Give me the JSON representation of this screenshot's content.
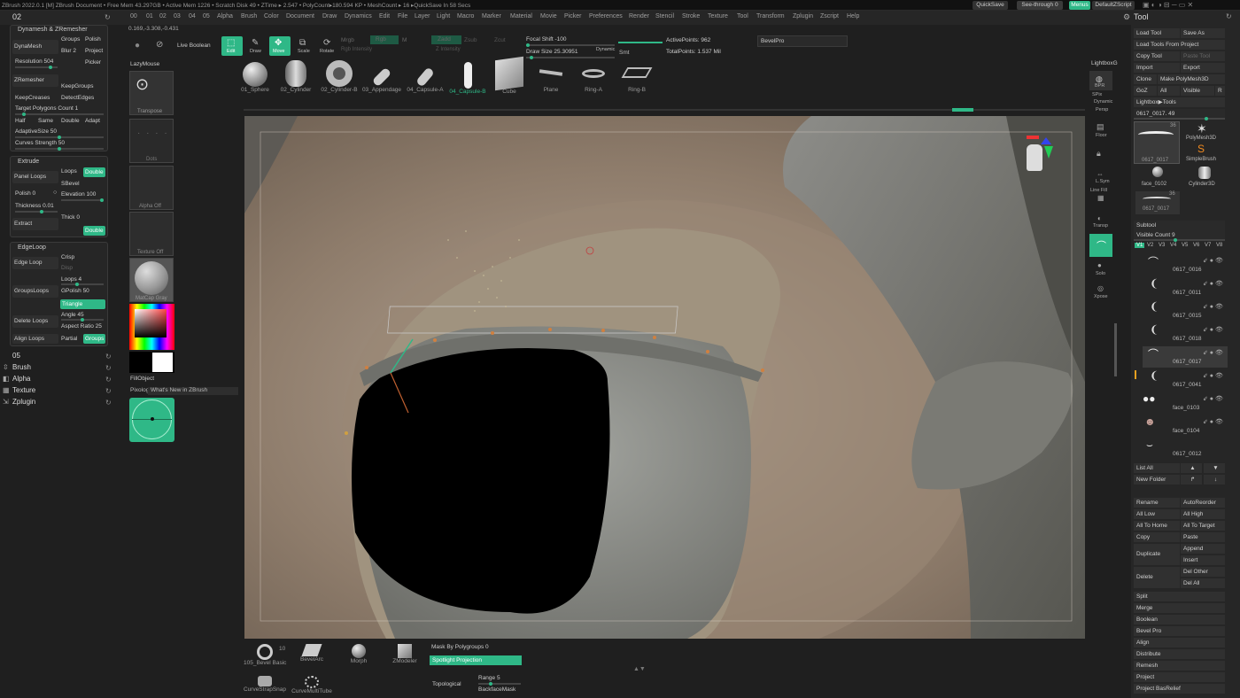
{
  "title_bar": {
    "text": "ZBrush 2022.0.1 [M]   ZBrush Document   • Free Mem 43.297GB • Active Mem 1226 • Scratch Disk 49 • ZTime ▸ 2.547 • PolyCount▸180.594 KP • MeshCount ▸ 16  ▸QuickSave In 58 Secs",
    "quicksave": "QuickSave",
    "see_through": "See-through  0",
    "menus": "Menus",
    "default_zscript": "DefaultZScript"
  },
  "menubar": {
    "left_label": "02",
    "items": [
      "00",
      "01",
      "02",
      "03",
      "04",
      "05",
      "Alpha",
      "Brush",
      "Color",
      "Document",
      "Draw",
      "Dynamics",
      "Edit",
      "File",
      "Layer",
      "Light",
      "Macro",
      "Marker",
      "Material",
      "Movie",
      "Picker",
      "Preferences",
      "Render",
      "Stencil",
      "Stroke",
      "Texture",
      "Tool",
      "Transform",
      "Zplugin",
      "Zscript",
      "Help"
    ]
  },
  "coords": "0.169,-3.308,-0.431",
  "top_toolbar": {
    "live_boolean": "Live Boolean",
    "edit": "Edit",
    "draw": "Draw",
    "move": "Move",
    "scale": "Scale",
    "rotate": "Rotate",
    "mrgb": "Mrgb",
    "rgb": "Rgb",
    "m": "M",
    "rgb_intensity": "Rgb Intensity",
    "zadd": "Zadd",
    "zsub": "Zsub",
    "zintensity": "Z Intensity",
    "focal_shift": "Focal Shift -100",
    "draw_size": "Draw Size 25.30951",
    "dynamic": "Dynamic",
    "smt": "Smt",
    "active_points": "ActivePoints: 962",
    "total_points": "TotalPoints: 1.537 Mil",
    "preset_name": "BevelPro"
  },
  "insert_brushes": [
    "01_Sphere",
    "02_Cylinder",
    "02_Cylinder-B",
    "03_Appendage",
    "04_Capsule-A",
    "04_Capsule-B",
    "Cube",
    "Plane",
    "Ring-A",
    "Ring-B"
  ],
  "insert_active": "04_Capsule-B",
  "left_panel": {
    "dynamesh_header": "Dynamesh & ZRemesher",
    "dynamesh": "DynaMesh",
    "groups": "Groups",
    "polish": "Polish",
    "blur": "Blur 2",
    "project": "Project",
    "resolution": "Resolution 504",
    "picker": "Picker",
    "zremesher": "ZRemesher",
    "keepgroups": "KeepGroups",
    "keepcreases": "KeepCreases",
    "detectedges": "DetectEdges",
    "target_poly": "Target Polygons Count 1",
    "half": "Half",
    "same": "Same",
    "double": "Double",
    "adapt": "Adapt",
    "adaptive_size": "AdaptiveSize 50",
    "curves_strength": "Curves Strength 50",
    "extrude_header": "Extrude",
    "panel_loops": "Panel Loops",
    "loops": "Loops",
    "double2": "Double",
    "sbevel": "SBevel",
    "polish2": "Polish 0",
    "elevation": "Elevation 100",
    "thickness": "Thickness 0.01",
    "extract": "Extract",
    "thick": "Thick 0",
    "double3": "Double",
    "edgeloop_header": "EdgeLoop",
    "edge_loop": "Edge Loop",
    "crisp": "Crisp",
    "disp": "Disp",
    "groupsloops": "GroupsLoops",
    "loops4": "Loops 4",
    "gpolish": "GPolish 50",
    "triangle": "Triangle",
    "delete_loops": "Delete Loops",
    "angle": "Angle 45",
    "aspect_ratio": "Aspect Ratio 25",
    "align_loops": "Align Loops",
    "partial": "Partial",
    "groups2": "Groups",
    "section": "05",
    "palettes": [
      "Brush",
      "Alpha",
      "Texture",
      "Zplugin"
    ]
  },
  "shelf": {
    "lazymouse": "LazyMouse",
    "transpose": "Transpose",
    "dots": "Dots",
    "alpha_off": "Alpha Off",
    "texture_off": "Texture Off",
    "material": "MatCap Gray",
    "fill_object": "FillObject",
    "pixologic": "Pixologic",
    "whats_new": "What's New in ZBrush"
  },
  "bottom_shelf": {
    "brush1": "105_Bevel Basic",
    "brush1_num": "10",
    "brush2": "BevelArc",
    "brush3": "Morph",
    "brush4": "ZModeler",
    "brush5": "CurveStrapSnap",
    "brush6": "CurveMultiTube",
    "mask_by_polygroups": "Mask By Polygroups 0",
    "spotlight_projection": "Spotlight Projection",
    "topological": "Topological",
    "range": "Range 5",
    "backface_mask": "BackfaceMask"
  },
  "right_tray": {
    "tool_title": "Tool",
    "load_tool": "Load Tool",
    "save_as": "Save As",
    "load_tools_from_project": "Load Tools From Project",
    "copy_tool": "Copy Tool",
    "paste_tool": "Paste Tool",
    "import": "Import",
    "export": "Export",
    "clone": "Clone",
    "make_polymesh": "Make PolyMesh3D",
    "goz": "GoZ",
    "all": "All",
    "visible": "Visible",
    "r": "R",
    "lightbox_tools": "Lightbox▶Tools",
    "current_tool": "0617_0017. 49",
    "thumbs": [
      "0617_0017",
      "PolyMesh3D",
      "SimpleBrush",
      "face_0102",
      "Cylinder3D",
      "0617_0017"
    ],
    "thumb_num1": "36",
    "thumb_num2": "36",
    "subtool_header": "Subtool",
    "visible_count": "Visible Count 9",
    "v_tabs": [
      "V1",
      "V2",
      "V3",
      "V4",
      "V5",
      "V6",
      "V7",
      "V8"
    ],
    "subtools": [
      "0617_0016",
      "0617_0011",
      "0617_0015",
      "0617_0018",
      "0617_0017",
      "0617_0041",
      "face_0103",
      "face_0104",
      "0617_0012"
    ],
    "list_all": "List All",
    "new_folder": "New Folder",
    "rename": "Rename",
    "autoreorder": "AutoReorder",
    "all_low": "All Low",
    "all_high": "All High",
    "all_to_home": "All To Home",
    "all_to_target": "All To Target",
    "copy": "Copy",
    "paste": "Paste",
    "duplicate": "Duplicate",
    "append": "Append",
    "insert": "Insert",
    "delete": "Delete",
    "del_other": "Del Other",
    "del_all": "Del All",
    "extra": [
      "Split",
      "Merge",
      "Boolean",
      "Bevel Pro",
      "Align",
      "Distribute",
      "Remesh",
      "Project",
      "Project BasRelief"
    ]
  },
  "right_shelf": {
    "items": [
      "BPR",
      "SPix",
      "Dynamic",
      "Persp",
      "Floor",
      "L.Sym",
      "Line Fill",
      "Transp",
      "Solo",
      "Xpose"
    ],
    "label_top": "LightboxG"
  },
  "colors": {
    "accent": "#2fb887",
    "bg": "#1f1f1f",
    "panel": "#262626",
    "canvas": "#897766"
  }
}
